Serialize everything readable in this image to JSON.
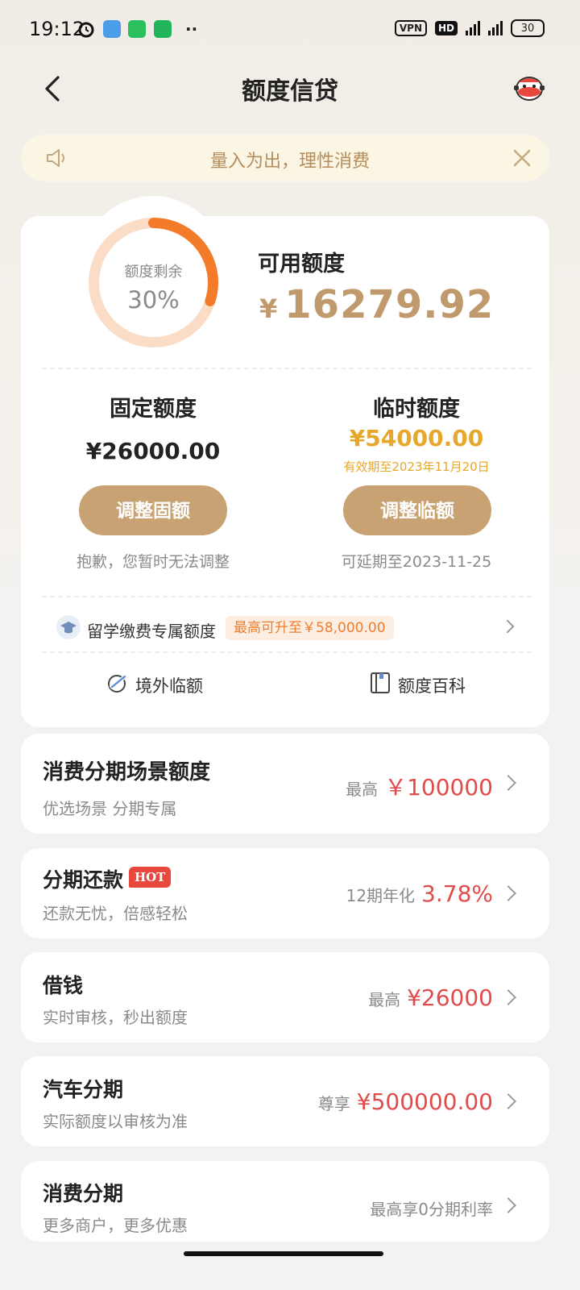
{
  "status": {
    "time": "19:12",
    "vpn": "VPN",
    "hd": "HD",
    "battery": "30"
  },
  "nav": {
    "title": "额度信贷",
    "back_icon": "back-arrow-icon",
    "service_icon": "mascot-icon"
  },
  "notice": {
    "text": "量入为出，理性消费",
    "icon": "speaker-icon",
    "close_icon": "close-icon"
  },
  "quota": {
    "ring_label": "额度剩余",
    "ring_percent": "30%",
    "ring_fraction": 0.3,
    "available_label": "可用额度",
    "currency": "¥",
    "available_amount": "16279.92",
    "fixed": {
      "title": "固定额度",
      "amount": "¥26000.00",
      "button": "调整固额",
      "hint": "抱歉，您暂时无法调整"
    },
    "temporary": {
      "title": "临时额度",
      "amount": "¥54000.00",
      "validity": "有效期至2023年11月20日",
      "button": "调整临额",
      "hint": "可延期至2023-11-25"
    },
    "study": {
      "label": "留学缴费专属额度",
      "tag": "最高可升至￥58,000.00"
    },
    "links": [
      {
        "label": "境外临额",
        "icon": "plane-globe-icon"
      },
      {
        "label": "额度百科",
        "icon": "book-icon"
      }
    ]
  },
  "products": [
    {
      "title": "消费分期场景额度",
      "subtitle": "优选场景 分期专属",
      "prefix": "最高",
      "value": "￥100000"
    },
    {
      "title": "分期还款",
      "badge": "HOT",
      "subtitle": "还款无忧，倍感轻松",
      "prefix": "12期年化",
      "value": "3.78%"
    },
    {
      "title": "借钱",
      "subtitle": "实时审核，秒出额度",
      "prefix": "最高",
      "value": "¥26000"
    },
    {
      "title": "汽车分期",
      "subtitle": "实际额度以审核为准",
      "prefix": "尊享",
      "value": "¥500000.00"
    },
    {
      "title": "消费分期",
      "subtitle": "更多商户，更多优惠",
      "prefix": "最高享0分期利率",
      "value": ""
    }
  ],
  "colors": {
    "accent": "#c8a273",
    "orange": "#f47b2a",
    "red": "#e04c4c",
    "gold": "#e6a72a"
  }
}
